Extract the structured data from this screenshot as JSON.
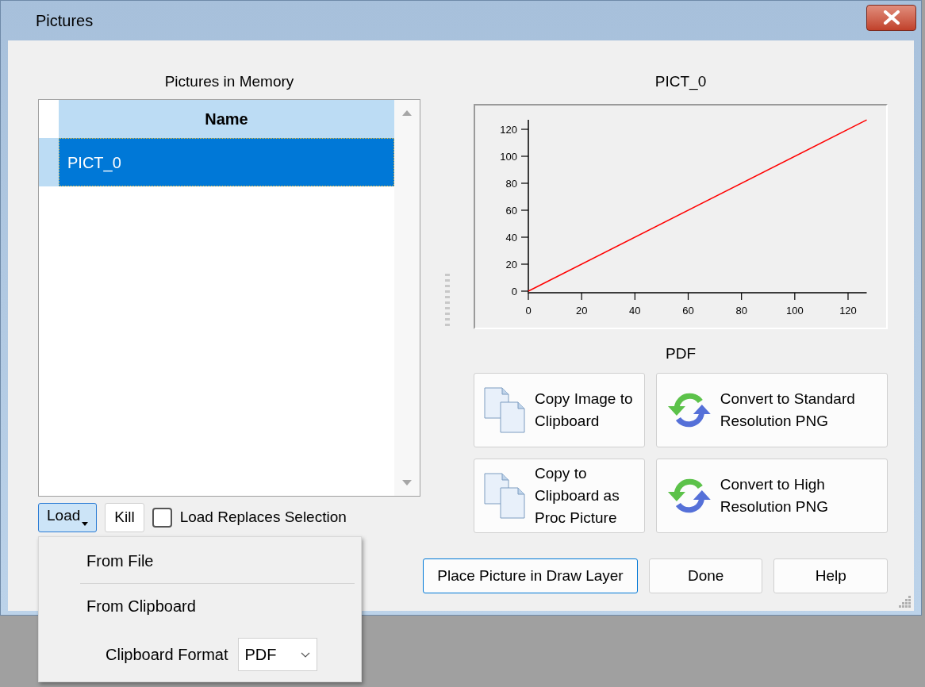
{
  "window": {
    "title": "Pictures"
  },
  "list_panel": {
    "title": "Pictures in Memory",
    "columns": [
      "Name"
    ],
    "rows": [
      {
        "name": "PICT_0",
        "selected": true
      }
    ]
  },
  "list_controls": {
    "load_button": "Load",
    "kill_button": "Kill",
    "checkbox": {
      "label": "Load Replaces Selection",
      "checked": false
    }
  },
  "load_menu": {
    "items": [
      "From File",
      "From Clipboard"
    ],
    "format_label": "Clipboard Format",
    "format_value": "PDF"
  },
  "preview": {
    "title": "PICT_0",
    "chart_data": {
      "type": "line",
      "x": [
        0,
        127
      ],
      "series": [
        {
          "color": "#ff0000",
          "values": [
            0,
            127
          ]
        }
      ],
      "xlim": [
        0,
        127
      ],
      "ylim": [
        0,
        127
      ],
      "xticks": [
        0,
        20,
        40,
        60,
        80,
        100,
        120
      ],
      "yticks": [
        0,
        20,
        40,
        60,
        80,
        100,
        120
      ]
    }
  },
  "format_caption": "PDF",
  "actions": [
    {
      "kind": "copy",
      "label": "Copy Image to Clipboard"
    },
    {
      "kind": "convert",
      "label": "Convert to Standard Resolution PNG"
    },
    {
      "kind": "copy",
      "label": "Copy to Clipboard as Proc Picture"
    },
    {
      "kind": "convert",
      "label": "Convert to High Resolution PNG"
    }
  ],
  "buttons": [
    {
      "label": "Place Picture in Draw Layer",
      "focused": true
    },
    {
      "label": "Done",
      "focused": false
    },
    {
      "label": "Help",
      "focused": false
    }
  ]
}
